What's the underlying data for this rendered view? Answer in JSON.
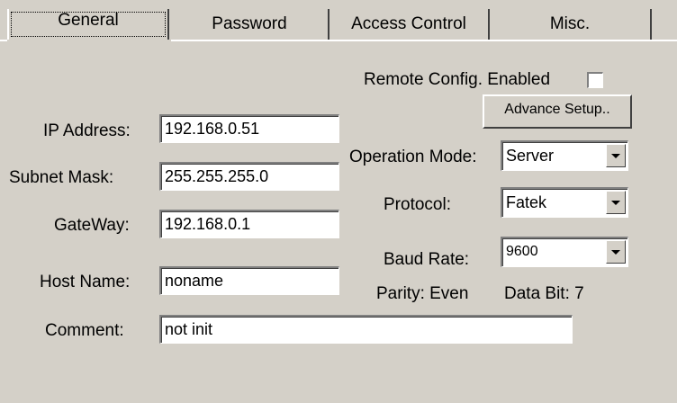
{
  "tabs": {
    "general": "General",
    "password": "Password",
    "access_control": "Access Control",
    "misc": "Misc."
  },
  "remote_config": {
    "label": "Remote Config. Enabled",
    "checked": false
  },
  "advance_setup_label": "Advance Setup..",
  "ip_address": {
    "label": "IP Address:",
    "value": "192.168.0.51"
  },
  "subnet_mask": {
    "label": "Subnet Mask:",
    "value": "255.255.255.0"
  },
  "gateway": {
    "label": "GateWay:",
    "value": "192.168.0.1"
  },
  "host_name": {
    "label": "Host Name:",
    "value": "noname"
  },
  "comment": {
    "label": "Comment:",
    "value": "not init"
  },
  "operation_mode": {
    "label": "Operation Mode:",
    "value": "Server"
  },
  "protocol": {
    "label": "Protocol:",
    "value": "Fatek"
  },
  "baud_rate": {
    "label": "Baud Rate:",
    "value": "9600"
  },
  "parity": "Parity: Even",
  "data_bit": "Data Bit: 7"
}
